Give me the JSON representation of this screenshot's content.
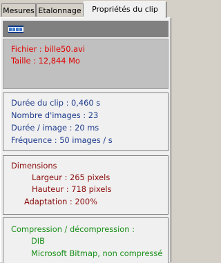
{
  "tabs": [
    {
      "label": "Mesures",
      "active": false
    },
    {
      "label": "Etalonnage",
      "active": false
    },
    {
      "label": "Propriétés du clip",
      "active": true
    }
  ],
  "header": {
    "icon": "film-icon"
  },
  "file_info": {
    "fichier": "Fichier : bille50.avi",
    "taille": "Taille : 12,844 Mo"
  },
  "timing": {
    "duree_clip": "Durée du clip : 0,460 s",
    "nombre_images": "Nombre d'images : 23",
    "duree_image": "Durée / image : 20 ms",
    "frequence": "Fréquence : 50 images / s"
  },
  "dimensions": {
    "title": "Dimensions",
    "largeur": "Largeur : 265 pixels",
    "hauteur": "Hauteur : 718 pixels",
    "adaptation": "Adaptation : 200%"
  },
  "compression": {
    "title": "Compression / décompression :",
    "codec": "DIB",
    "codec_name": "Microsoft Bitmap, non compressé"
  },
  "colors": {
    "file": "#e00000",
    "timing": "#1c3a8c",
    "dimensions": "#8a0a0a",
    "compression": "#1a8f1a"
  }
}
